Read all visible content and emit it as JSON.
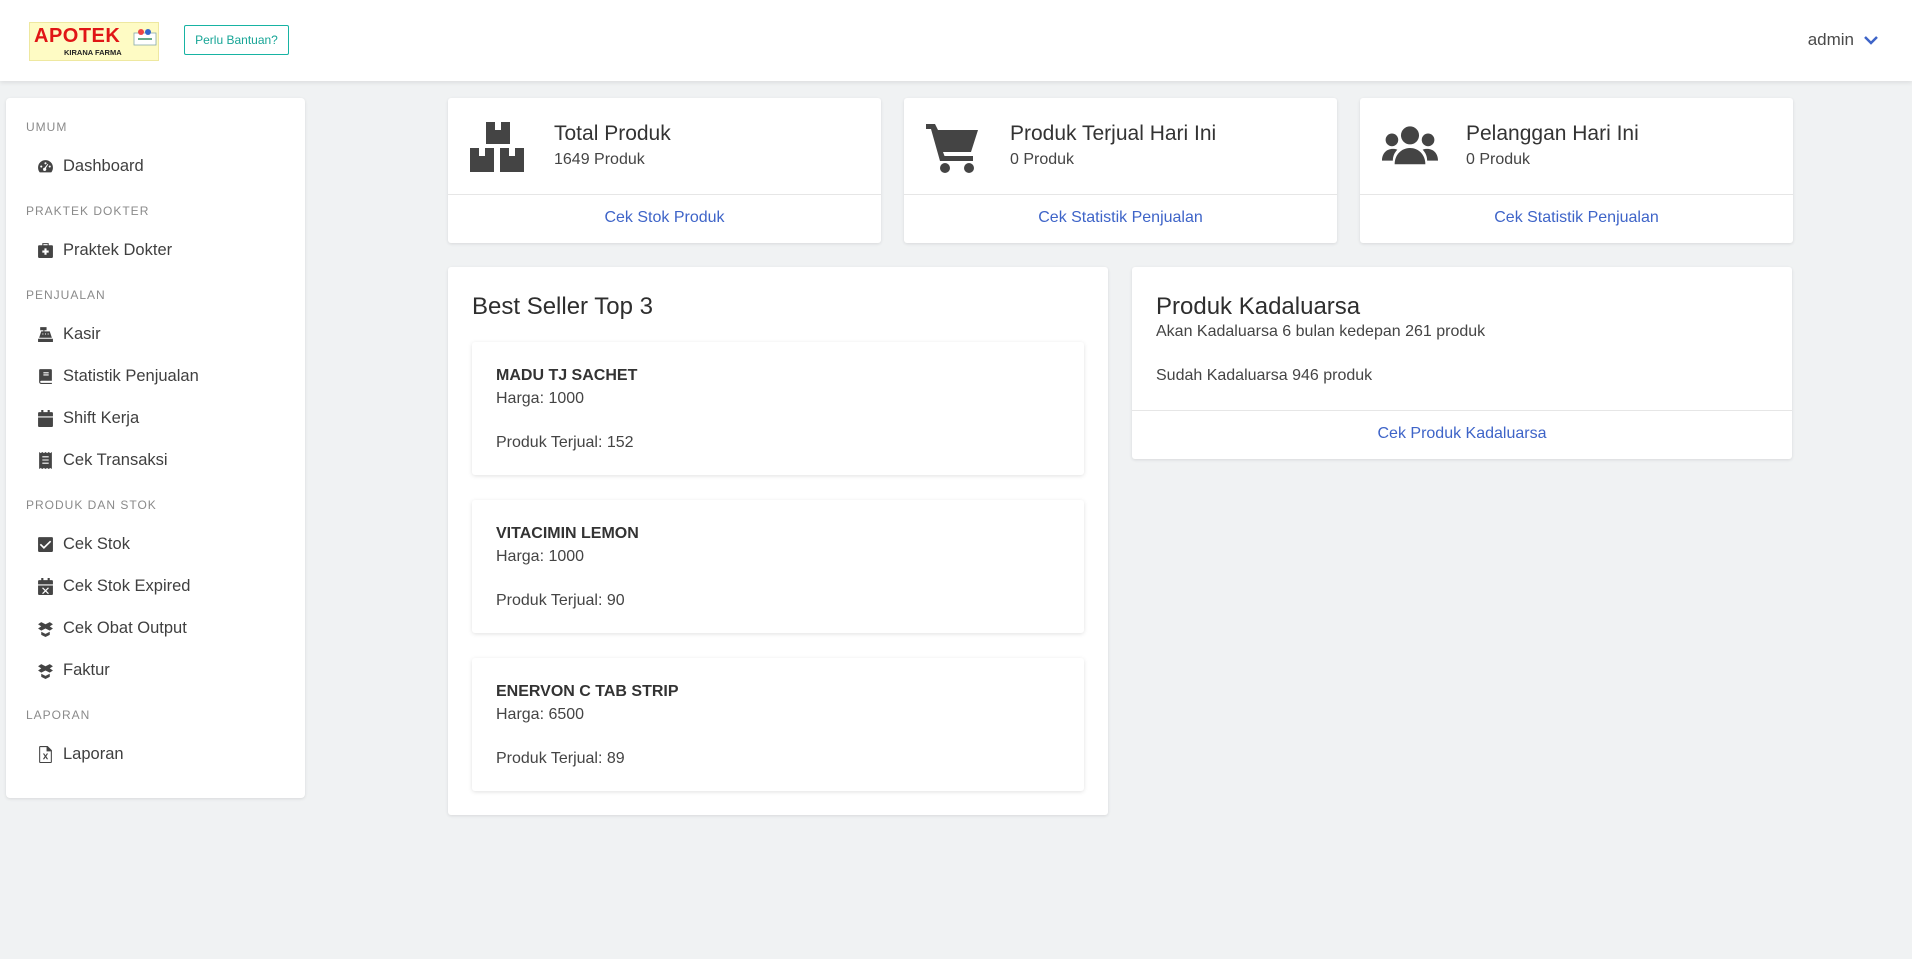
{
  "header": {
    "logo_text": "APOTEK",
    "logo_subtext": "KIRANA FARMA",
    "help_button": "Perlu Bantuan?",
    "user_name": "admin"
  },
  "sidebar": {
    "sections": [
      {
        "label": "UMUM",
        "items": [
          {
            "label": "Dashboard",
            "icon": "dashboard-icon"
          }
        ]
      },
      {
        "label": "PRAKTEK DOKTER",
        "items": [
          {
            "label": "Praktek Dokter",
            "icon": "medkit-icon"
          }
        ]
      },
      {
        "label": "PENJUALAN",
        "items": [
          {
            "label": "Kasir",
            "icon": "cash-register-icon"
          },
          {
            "label": "Statistik Penjualan",
            "icon": "book-icon"
          },
          {
            "label": "Shift Kerja",
            "icon": "calendar-icon"
          },
          {
            "label": "Cek Transaksi",
            "icon": "receipt-icon"
          }
        ]
      },
      {
        "label": "PRODUK DAN STOK",
        "items": [
          {
            "label": "Cek Stok",
            "icon": "check-square-icon"
          },
          {
            "label": "Cek Stok Expired",
            "icon": "calendar-x-icon"
          },
          {
            "label": "Cek Obat Output",
            "icon": "boxes-icon"
          },
          {
            "label": "Faktur",
            "icon": "boxes-icon"
          }
        ]
      },
      {
        "label": "LAPORAN",
        "items": [
          {
            "label": "Laporan",
            "icon": "file-excel-icon"
          }
        ]
      }
    ]
  },
  "stats": [
    {
      "title": "Total Produk",
      "value": "1649 Produk",
      "link": "Cek Stok Produk",
      "icon": "boxes-icon"
    },
    {
      "title": "Produk Terjual Hari Ini",
      "value": "0 Produk",
      "link": "Cek Statistik Penjualan",
      "icon": "cart-icon"
    },
    {
      "title": "Pelanggan Hari Ini",
      "value": "0 Produk",
      "link": "Cek Statistik Penjualan",
      "icon": "users-icon"
    }
  ],
  "best_seller": {
    "title": "Best Seller Top 3",
    "products": [
      {
        "name": "MADU TJ SACHET",
        "price": "Harga: 1000",
        "sold": "Produk Terjual: 152"
      },
      {
        "name": "VITACIMIN LEMON",
        "price": "Harga: 1000",
        "sold": "Produk Terjual: 90"
      },
      {
        "name": "ENERVON C TAB STRIP",
        "price": "Harga: 6500",
        "sold": "Produk Terjual: 89"
      }
    ]
  },
  "expired": {
    "title": "Produk Kadaluarsa",
    "upcoming": "Akan Kadaluarsa 6 bulan kedepan 261 produk",
    "already": "Sudah Kadaluarsa 946 produk",
    "link": "Cek Produk Kadaluarsa"
  }
}
